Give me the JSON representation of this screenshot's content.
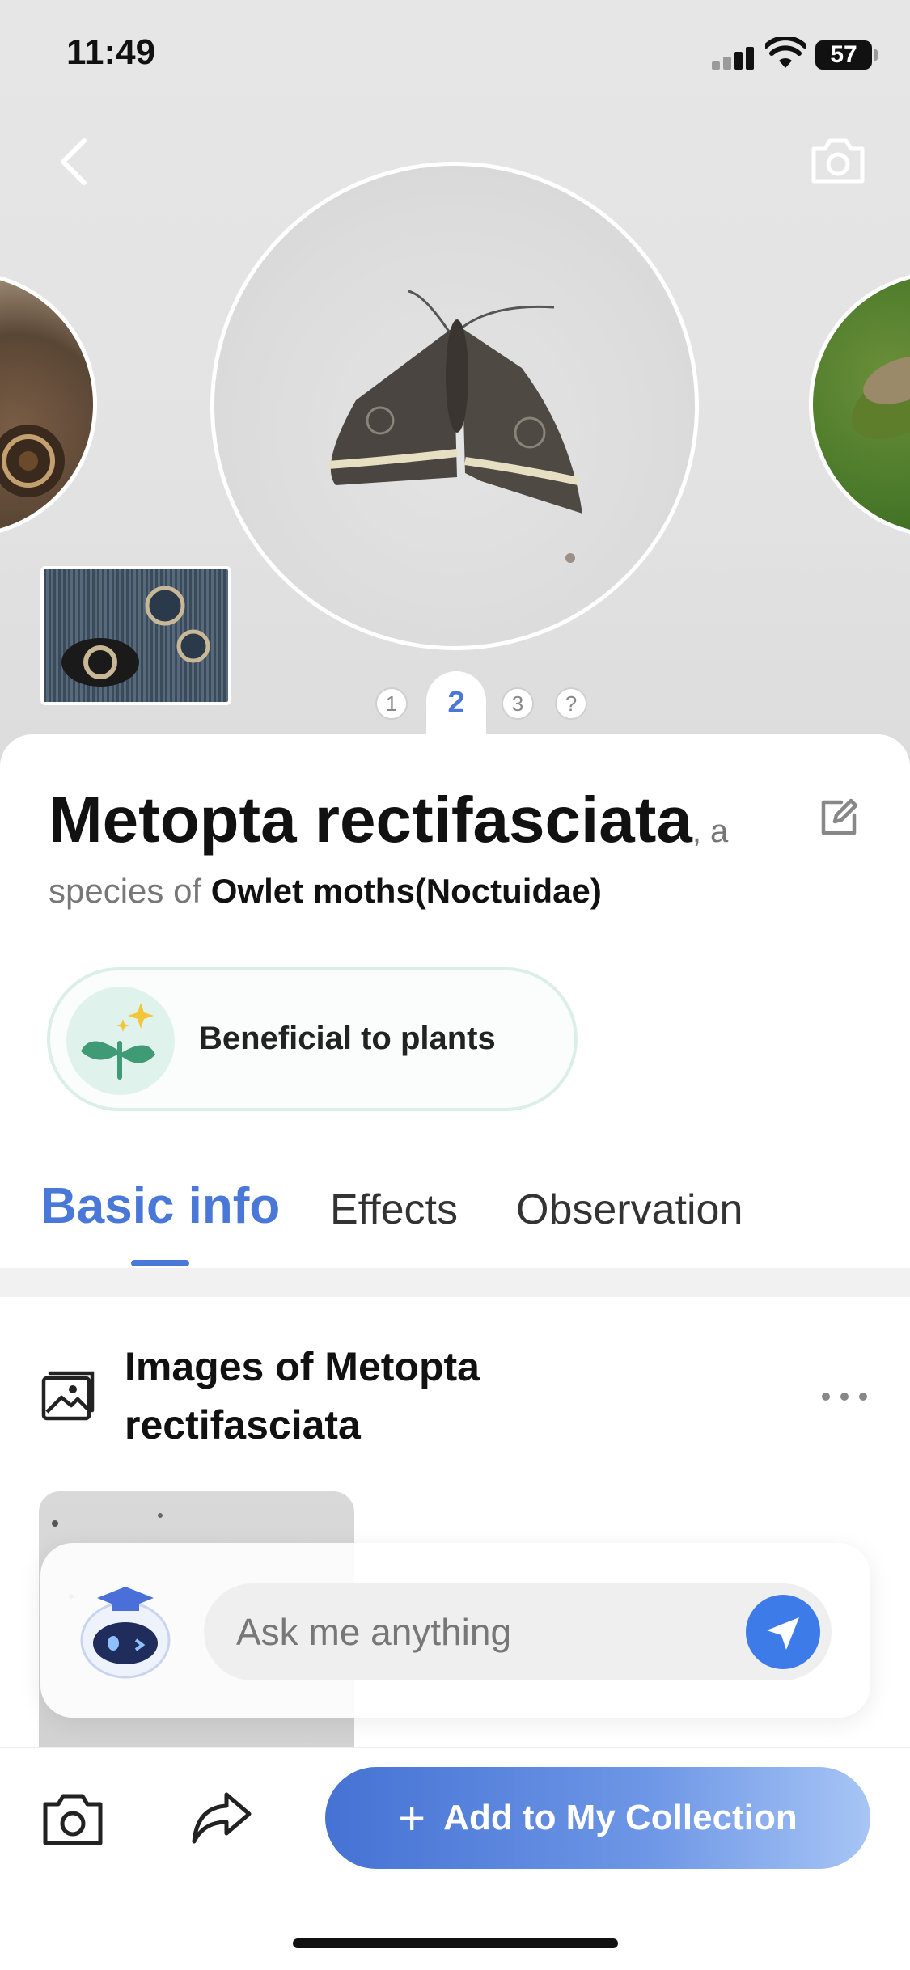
{
  "status": {
    "time": "11:49",
    "battery": "57"
  },
  "carousel": {
    "pages": [
      "1",
      "2",
      "3",
      "?"
    ],
    "active_page": "2"
  },
  "species": {
    "name": "Metopta rectifasciata",
    "suffix": ", a",
    "sub_prefix": "species of ",
    "family": "Owlet moths(Noctuidae)"
  },
  "badge": {
    "label": "Beneficial to plants",
    "icon": "sprout-sparkle-icon"
  },
  "tabs": [
    {
      "label": "Basic info",
      "active": true
    },
    {
      "label": "Effects",
      "active": false
    },
    {
      "label": "Observation",
      "active": false
    }
  ],
  "section": {
    "title": "Images of Metopta rectifasciata"
  },
  "chat": {
    "placeholder": "Ask me anything"
  },
  "bottom": {
    "add_button": "Add to My Collection",
    "plus": "+"
  },
  "colors": {
    "accent": "#4a78d8",
    "badge_bg": "#dff3ec",
    "send": "#3c7be8"
  }
}
